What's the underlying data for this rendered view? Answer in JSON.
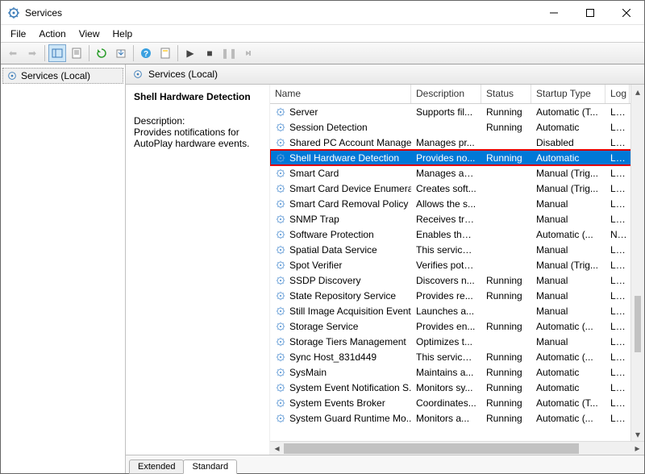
{
  "window": {
    "title": "Services"
  },
  "menu": {
    "file": "File",
    "action": "Action",
    "view": "View",
    "help": "Help"
  },
  "tree": {
    "root": "Services (Local)"
  },
  "pane": {
    "header": "Services (Local)"
  },
  "detail": {
    "title": "Shell Hardware Detection",
    "desc_label": "Description:",
    "desc_text": "Provides notifications for AutoPlay hardware events."
  },
  "columns": {
    "name": "Name",
    "description": "Description",
    "status": "Status",
    "startup": "Startup Type",
    "logon": "Log"
  },
  "tabs": {
    "extended": "Extended",
    "standard": "Standard"
  },
  "services": [
    {
      "name": "Server",
      "description": "Supports fil...",
      "status": "Running",
      "startup": "Automatic (T...",
      "logon": "Loc"
    },
    {
      "name": "Session Detection",
      "description": "",
      "status": "Running",
      "startup": "Automatic",
      "logon": "Loc"
    },
    {
      "name": "Shared PC Account Manager",
      "description": "Manages pr...",
      "status": "",
      "startup": "Disabled",
      "logon": "Loc"
    },
    {
      "name": "Shell Hardware Detection",
      "description": "Provides no...",
      "status": "Running",
      "startup": "Automatic",
      "logon": "Loc",
      "selected": true
    },
    {
      "name": "Smart Card",
      "description": "Manages ac...",
      "status": "",
      "startup": "Manual (Trig...",
      "logon": "Loc"
    },
    {
      "name": "Smart Card Device Enumera...",
      "description": "Creates soft...",
      "status": "",
      "startup": "Manual (Trig...",
      "logon": "Loc"
    },
    {
      "name": "Smart Card Removal Policy",
      "description": "Allows the s...",
      "status": "",
      "startup": "Manual",
      "logon": "Loc"
    },
    {
      "name": "SNMP Trap",
      "description": "Receives tra...",
      "status": "",
      "startup": "Manual",
      "logon": "Loc"
    },
    {
      "name": "Software Protection",
      "description": "Enables the ...",
      "status": "",
      "startup": "Automatic (...",
      "logon": "Net"
    },
    {
      "name": "Spatial Data Service",
      "description": "This service ...",
      "status": "",
      "startup": "Manual",
      "logon": "Loc"
    },
    {
      "name": "Spot Verifier",
      "description": "Verifies pote...",
      "status": "",
      "startup": "Manual (Trig...",
      "logon": "Loc"
    },
    {
      "name": "SSDP Discovery",
      "description": "Discovers n...",
      "status": "Running",
      "startup": "Manual",
      "logon": "Loc"
    },
    {
      "name": "State Repository Service",
      "description": "Provides re...",
      "status": "Running",
      "startup": "Manual",
      "logon": "Loc"
    },
    {
      "name": "Still Image Acquisition Events",
      "description": "Launches a...",
      "status": "",
      "startup": "Manual",
      "logon": "Loc"
    },
    {
      "name": "Storage Service",
      "description": "Provides en...",
      "status": "Running",
      "startup": "Automatic (...",
      "logon": "Loc"
    },
    {
      "name": "Storage Tiers Management",
      "description": "Optimizes t...",
      "status": "",
      "startup": "Manual",
      "logon": "Loc"
    },
    {
      "name": "Sync Host_831d449",
      "description": "This service ...",
      "status": "Running",
      "startup": "Automatic (...",
      "logon": "Loc"
    },
    {
      "name": "SysMain",
      "description": "Maintains a...",
      "status": "Running",
      "startup": "Automatic",
      "logon": "Loc"
    },
    {
      "name": "System Event Notification S...",
      "description": "Monitors sy...",
      "status": "Running",
      "startup": "Automatic",
      "logon": "Loc"
    },
    {
      "name": "System Events Broker",
      "description": "Coordinates...",
      "status": "Running",
      "startup": "Automatic (T...",
      "logon": "Loc"
    },
    {
      "name": "System Guard Runtime Mo...",
      "description": "Monitors a...",
      "status": "Running",
      "startup": "Automatic (...",
      "logon": "Loc"
    }
  ]
}
